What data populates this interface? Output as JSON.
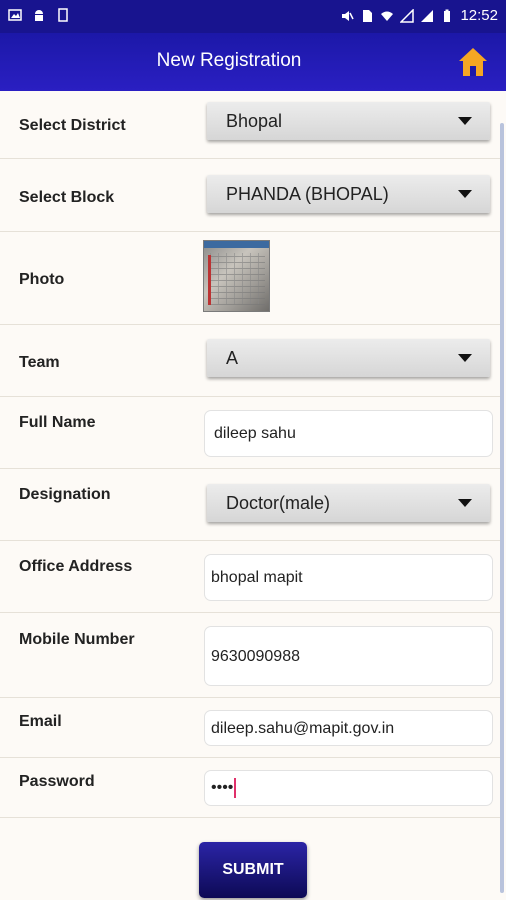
{
  "status_bar": {
    "time": "12:52"
  },
  "app_bar": {
    "title": "New Registration",
    "home_icon": "home-icon"
  },
  "form": {
    "district": {
      "label": "Select District",
      "value": "Bhopal"
    },
    "block": {
      "label": "Select Block",
      "value": "PHANDA (BHOPAL)"
    },
    "photo": {
      "label": "Photo"
    },
    "team": {
      "label": "Team",
      "value": "A"
    },
    "full_name": {
      "label": "Full Name",
      "value": "dileep sahu"
    },
    "designation": {
      "label": "Designation",
      "value": "Doctor(male)"
    },
    "office_address": {
      "label": "Office Address",
      "value": "bhopal mapit"
    },
    "mobile": {
      "label": "Mobile Number",
      "value": "9630090988"
    },
    "email": {
      "label": "Email",
      "value": "dileep.sahu@mapit.gov.in"
    },
    "password": {
      "label": "Password",
      "value": "••••"
    },
    "submit_label": "SUBMIT"
  },
  "colors": {
    "app_bar": "#1c18a8",
    "status_bar": "#18148f",
    "home_icon": "#f5a623",
    "submit": "#1a1680"
  }
}
